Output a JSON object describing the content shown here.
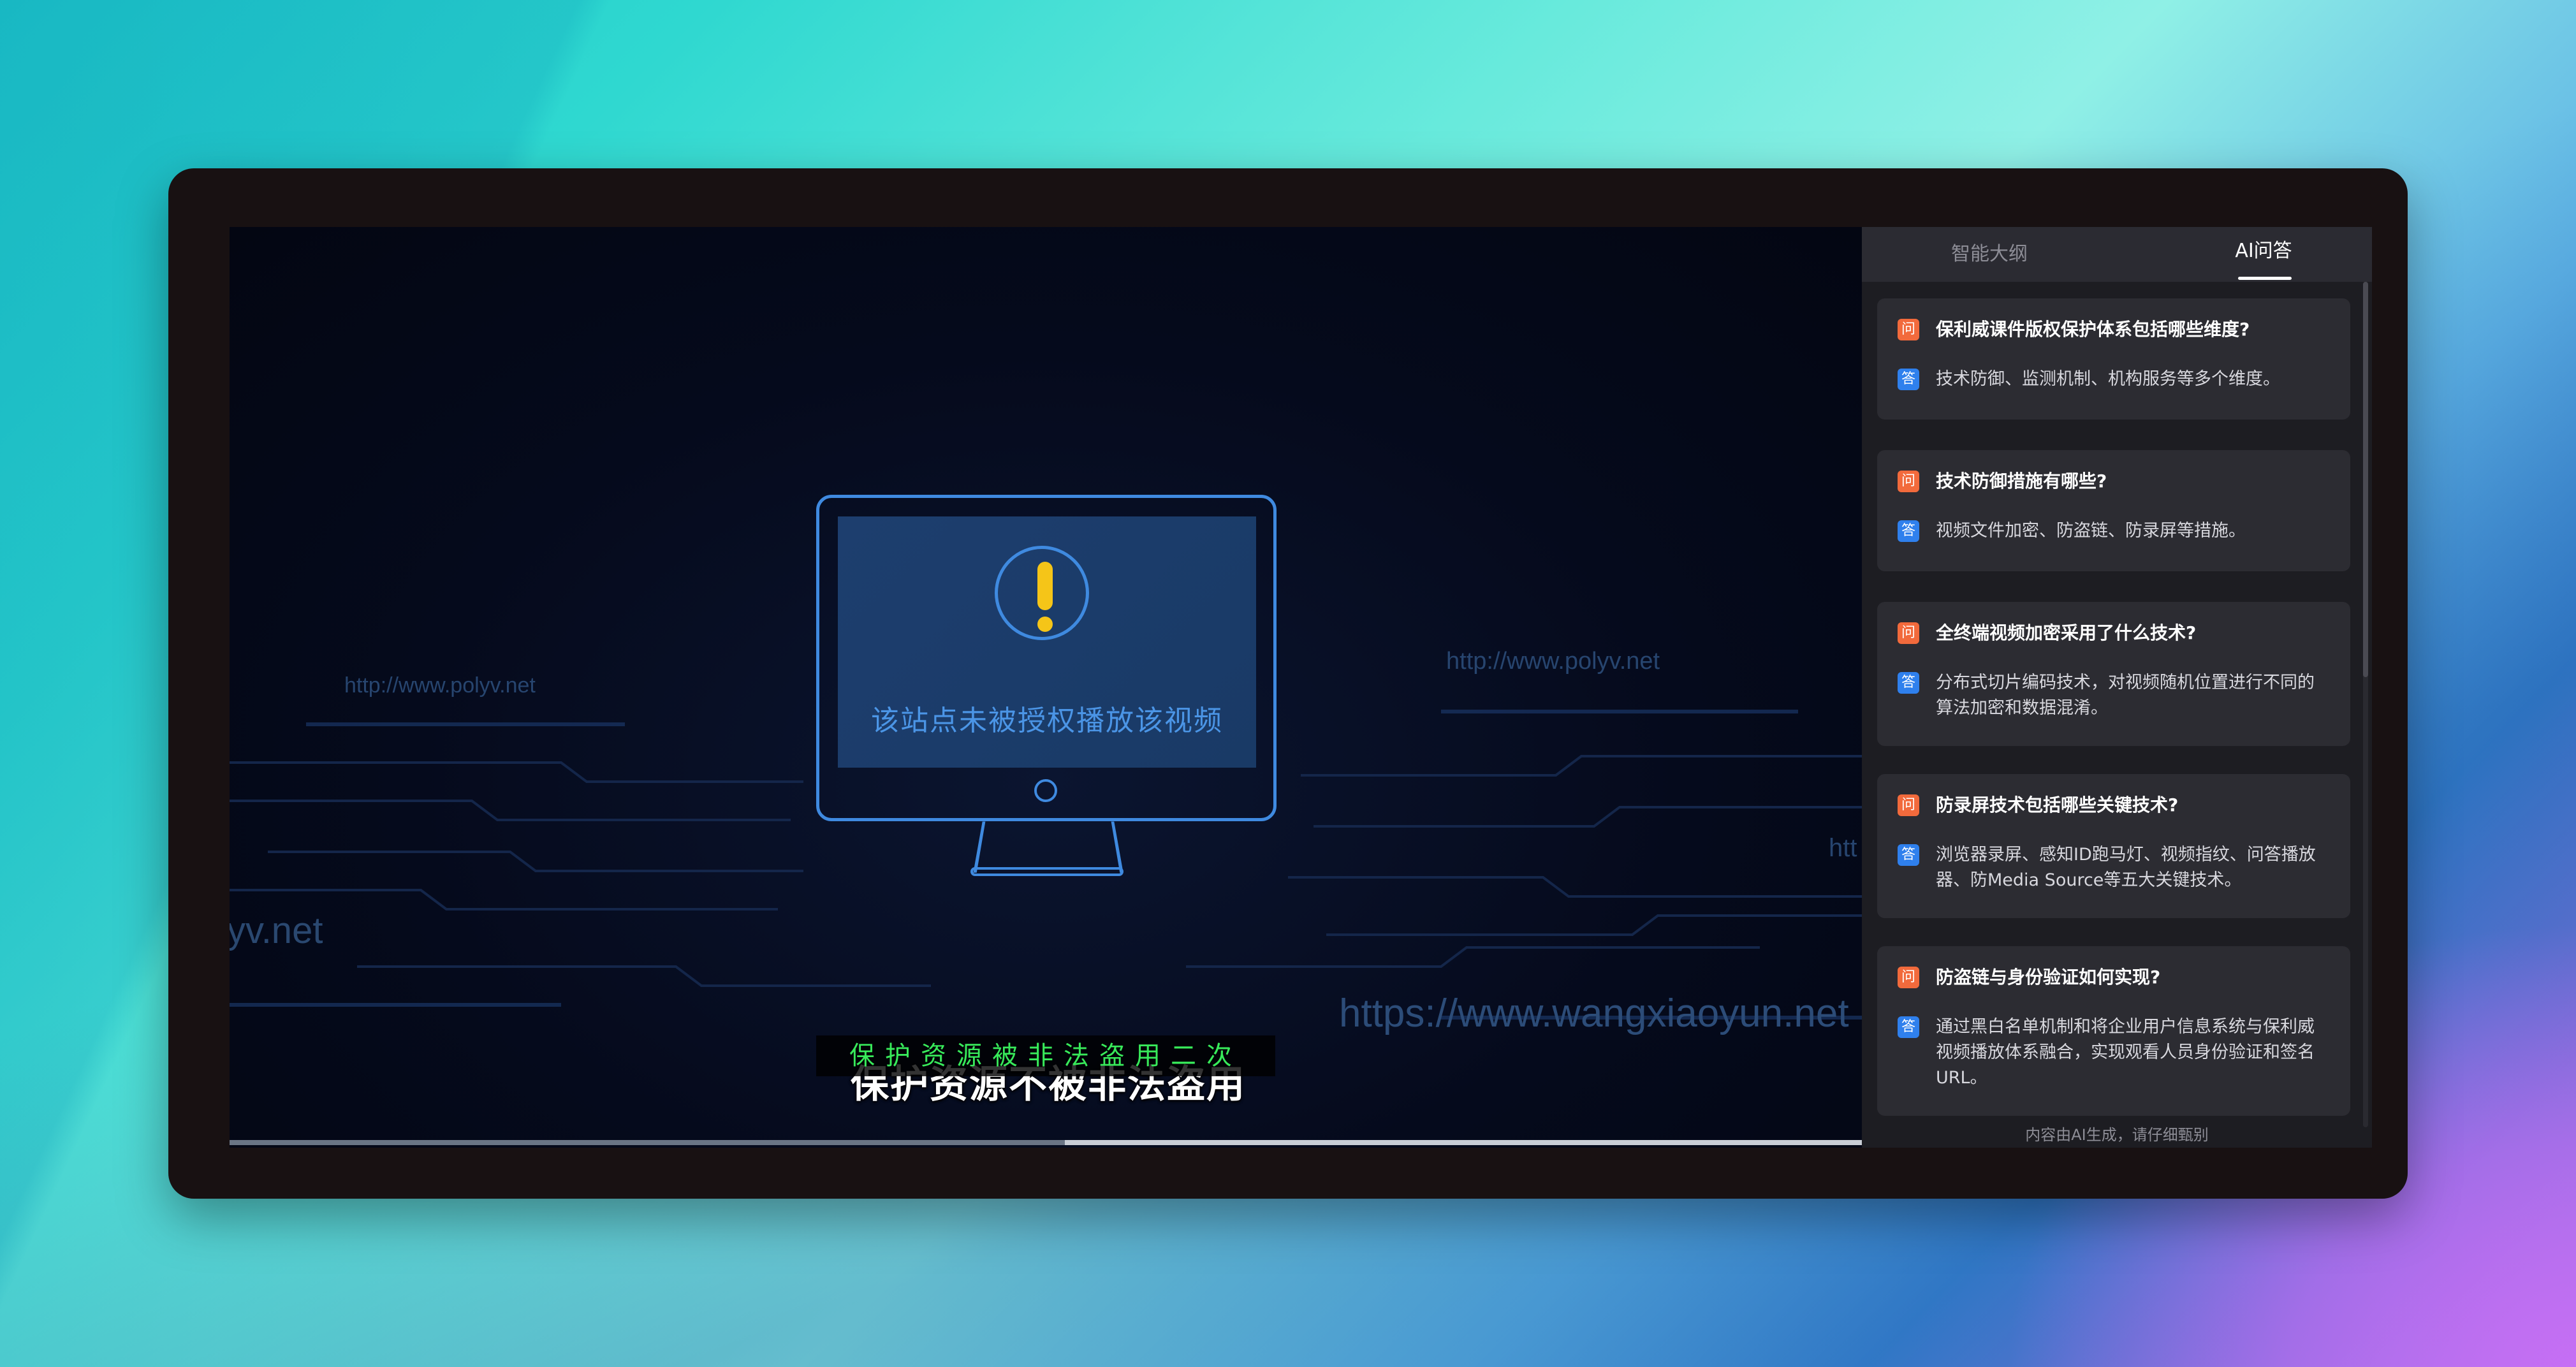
{
  "video": {
    "watermarks": [
      "http://www.polyv.net",
      "http://www.polyv.net",
      "yv.net",
      "https://www.wangxiaoyun.net",
      "htt"
    ],
    "screen_message": "该站点未被授权播放该视频",
    "subtitle_main": "保护资源不被非法盗用",
    "subtitle_secondary": "保护资源被非法盗用二次",
    "progress_fraction": 0.51
  },
  "panel": {
    "tabs": [
      "智能大纲",
      "AI问答"
    ],
    "active_tab": "AI问答",
    "q_badge": "问",
    "a_badge": "答",
    "qa": [
      {
        "q": "保利威课件版权保护体系包括哪些维度?",
        "a": "技术防御、监测机制、机构服务等多个维度。"
      },
      {
        "q": "技术防御措施有哪些?",
        "a": "视频文件加密、防盗链、防录屏等措施。"
      },
      {
        "q": "全终端视频加密采用了什么技术?",
        "a": "分布式切片编码技术，对视频随机位置进行不同的算法加密和数据混淆。"
      },
      {
        "q": "防录屏技术包括哪些关键技术?",
        "a": "浏览器录屏、感知ID跑马灯、视频指纹、问答播放器、防Media Source等五大关键技术。"
      },
      {
        "q": "防盗链与身份验证如何实现?",
        "a": "通过黑白名单机制和将企业用户信息系统与保利威视频播放体系融合，实现观看人员身份验证和签名URL。"
      }
    ],
    "footer": "内容由AI生成，请仔细甄别"
  },
  "colors": {
    "accent_blue": "#3f8ae0",
    "warning_yellow": "#f5c518",
    "subtitle_green": "#38ea5a",
    "q_badge": "#f26a3c",
    "a_badge": "#2f80ed"
  }
}
